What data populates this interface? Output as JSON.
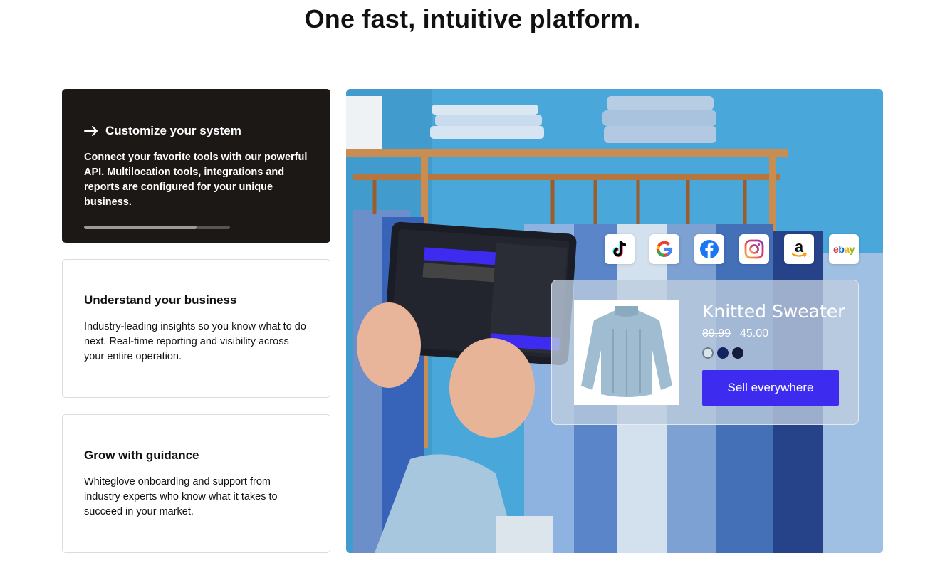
{
  "page": {
    "title": "One fast, intuitive platform."
  },
  "features": [
    {
      "title": "Customize your system",
      "body": "Connect your favorite tools with our powerful API. Multilocation tools, integrations and reports are configured for your unique business.",
      "active": true,
      "progress": 0.77
    },
    {
      "title": "Understand your business",
      "body": "Industry-leading insights so you know what to do next. Real-time reporting and visibility across your entire operation.",
      "active": false
    },
    {
      "title": "Grow with guidance",
      "body": "Whiteglove onboarding and support from industry experts who know what it takes to succeed in your market.",
      "active": false
    }
  ],
  "hero": {
    "channels": [
      "tiktok-icon",
      "google-icon",
      "facebook-icon",
      "instagram-icon",
      "amazon-icon",
      "ebay-icon"
    ],
    "ebay_text": "ebay",
    "product": {
      "name": "Knitted Sweater",
      "old_price": "89.99",
      "new_price": "45.00",
      "swatches": [
        "#d9e4ea",
        "#12235f",
        "#141b3d"
      ],
      "cta": "Sell everywhere"
    }
  },
  "colors": {
    "accent": "#3d2bf0",
    "dark_card": "#1c1816",
    "hero_bg": "#4aa6d8"
  }
}
